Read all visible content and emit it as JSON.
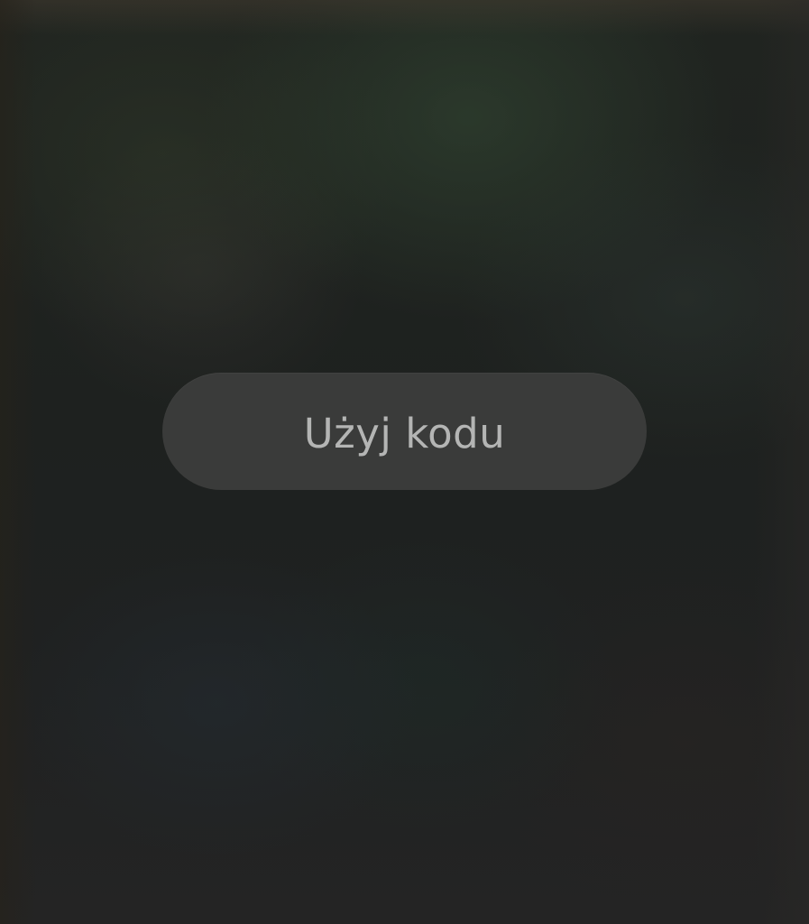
{
  "lock_screen": {
    "use_code_button": {
      "label": "Użyj kodu"
    }
  },
  "colors": {
    "background": "#1f2120",
    "button_fill": "#3a3b3a",
    "button_text": "#b4b5b4"
  }
}
